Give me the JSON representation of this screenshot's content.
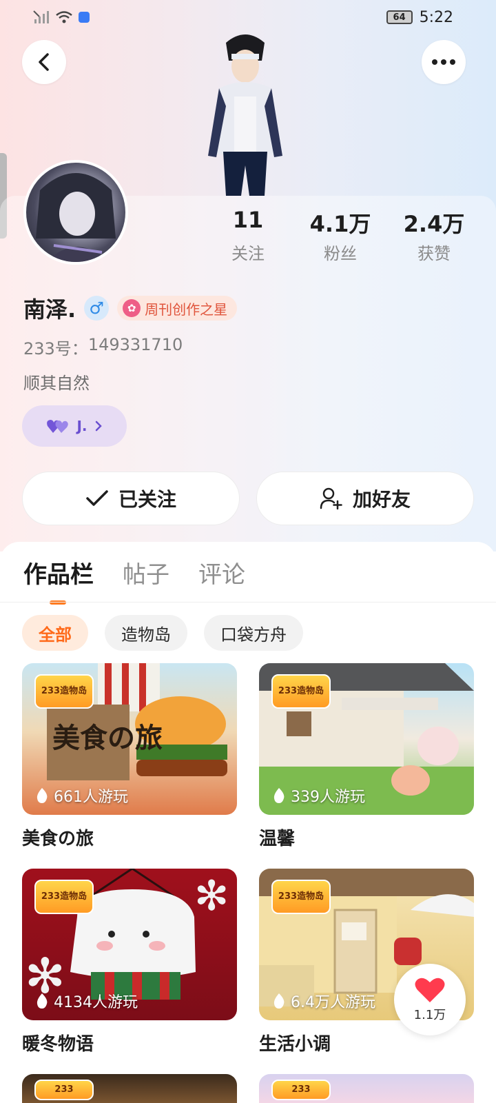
{
  "status_bar": {
    "time": "5:22",
    "battery": "64"
  },
  "stats": [
    {
      "value": "11",
      "label": "关注"
    },
    {
      "value": "4.1万",
      "label": "粉丝"
    },
    {
      "value": "2.4万",
      "label": "获赞"
    }
  ],
  "profile": {
    "name": "南泽.",
    "gender_symbol": "♂",
    "creator_badge": "周刊创作之星",
    "id_prefix": "233号：",
    "id_value": "149331710",
    "bio": "顺其自然",
    "friend_chip_name": "J."
  },
  "actions": {
    "follow_label": "已关注",
    "add_friend_label": "加好友"
  },
  "tabs": [
    {
      "label": "作品栏",
      "active": true
    },
    {
      "label": "帖子",
      "active": false
    },
    {
      "label": "评论",
      "active": false
    }
  ],
  "filters": [
    {
      "label": "全部",
      "active": true
    },
    {
      "label": "造物岛",
      "active": false
    },
    {
      "label": "口袋方舟",
      "active": false
    }
  ],
  "logo_text": {
    "line1": "233",
    "line2": "造物岛"
  },
  "works": [
    {
      "title": "美食の旅",
      "plays": "661人游玩",
      "colors": [
        "#c9e6f2",
        "#e07b4a"
      ]
    },
    {
      "title": "温馨",
      "plays": "339人游玩",
      "colors": [
        "#b8e2f6",
        "#f1eadf"
      ]
    },
    {
      "title": "暖冬物语",
      "plays": "4134人游玩",
      "colors": [
        "#a0101c",
        "#7c0d18"
      ]
    },
    {
      "title": "生活小调",
      "plays": "6.4万人游玩",
      "colors": [
        "#f6e6b8",
        "#e7c97a"
      ]
    }
  ],
  "like_fab": {
    "count": "1.1万"
  },
  "icons": {
    "back": "back-arrow-icon",
    "more": "more-dots-icon",
    "heart": "heart-icon",
    "check": "check-icon",
    "add_friend": "add-friend-icon",
    "flame": "flame-icon"
  },
  "colors": {
    "accent": "#ff7a1f",
    "badge": "#e0553c",
    "friend_chip": "#6a4fd0",
    "like": "#ff3b4e"
  }
}
